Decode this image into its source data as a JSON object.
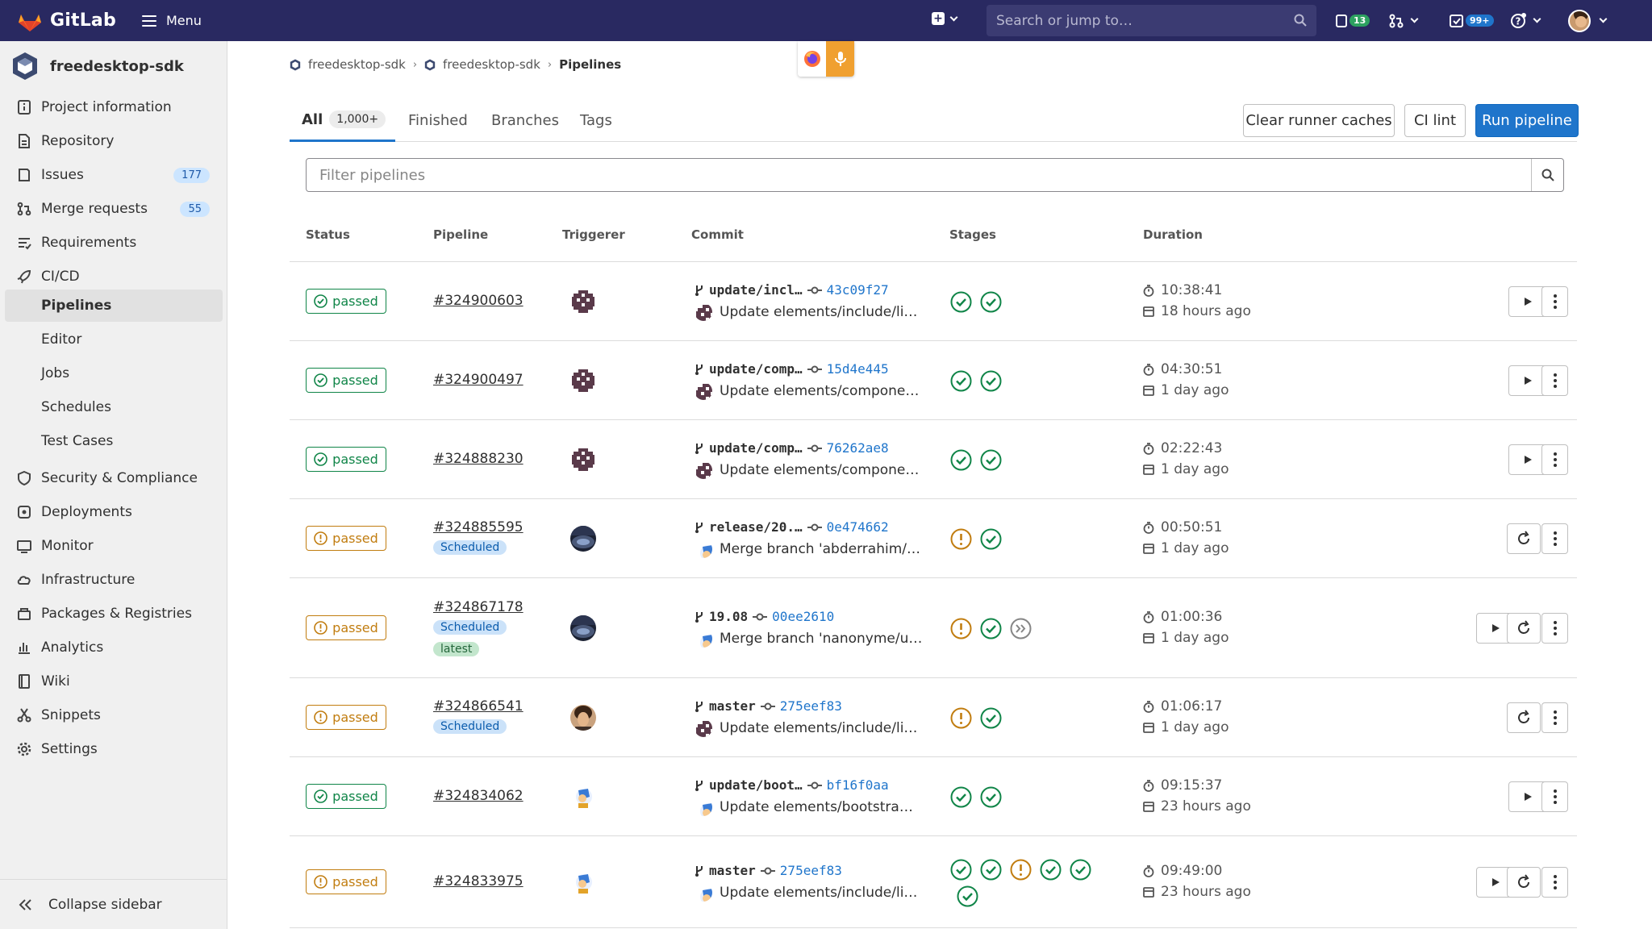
{
  "navbar": {
    "brand": "GitLab",
    "menu_label": "Menu",
    "search_placeholder": "Search or jump to…",
    "issues_count": "13",
    "todos_count": "99+"
  },
  "sidebar": {
    "project_name": "freedesktop-sdk",
    "items": [
      {
        "label": "Project information",
        "icon": "info-icon"
      },
      {
        "label": "Repository",
        "icon": "document-icon"
      },
      {
        "label": "Issues",
        "icon": "issues-icon",
        "count": "177"
      },
      {
        "label": "Merge requests",
        "icon": "merge-request-icon",
        "count": "55"
      },
      {
        "label": "Requirements",
        "icon": "requirements-icon"
      },
      {
        "label": "CI/CD",
        "icon": "rocket-icon"
      }
    ],
    "cicd_sub": [
      "Pipelines",
      "Editor",
      "Jobs",
      "Schedules",
      "Test Cases"
    ],
    "items2": [
      {
        "label": "Security & Compliance",
        "icon": "shield-icon"
      },
      {
        "label": "Deployments",
        "icon": "deployments-icon"
      },
      {
        "label": "Monitor",
        "icon": "monitor-icon"
      },
      {
        "label": "Infrastructure",
        "icon": "cloud-icon"
      },
      {
        "label": "Packages & Registries",
        "icon": "package-icon"
      },
      {
        "label": "Analytics",
        "icon": "chart-icon"
      },
      {
        "label": "Wiki",
        "icon": "book-icon"
      },
      {
        "label": "Snippets",
        "icon": "scissors-icon"
      },
      {
        "label": "Settings",
        "icon": "gear-icon"
      }
    ],
    "collapse_label": "Collapse sidebar"
  },
  "breadcrumb": [
    "freedesktop-sdk",
    "freedesktop-sdk",
    "Pipelines"
  ],
  "tabs": {
    "all": "All",
    "all_count": "1,000+",
    "finished": "Finished",
    "branches": "Branches",
    "tags": "Tags"
  },
  "buttons": {
    "clear_caches": "Clear runner caches",
    "ci_lint": "CI lint",
    "run_pipeline": "Run pipeline"
  },
  "filter_placeholder": "Filter pipelines",
  "columns": [
    "Status",
    "Pipeline",
    "Triggerer",
    "Commit",
    "Stages",
    "Duration"
  ],
  "pipelines": [
    {
      "status": "passed",
      "warn": false,
      "id": "#324900603",
      "ref": "update/incl…",
      "sha": "43c09f27",
      "message": "Update elements/include/li…",
      "avatar": "bot",
      "duration": "10:38:41",
      "finished": "18 hours ago",
      "tags": [],
      "stages": [
        "ok",
        "ok"
      ]
    },
    {
      "status": "passed",
      "warn": false,
      "id": "#324900497",
      "ref": "update/comp…",
      "sha": "15d4e445",
      "message": "Update elements/compone…",
      "avatar": "bot",
      "duration": "04:30:51",
      "finished": "1 day ago",
      "tags": [],
      "stages": [
        "ok",
        "ok"
      ]
    },
    {
      "status": "passed",
      "warn": false,
      "id": "#324888230",
      "ref": "update/comp…",
      "sha": "76262ae8",
      "message": "Update elements/compone…",
      "avatar": "bot",
      "duration": "02:22:43",
      "finished": "1 day ago",
      "tags": [],
      "stages": [
        "ok",
        "ok"
      ]
    },
    {
      "status": "passed",
      "warn": true,
      "id": "#324885595",
      "ref": "release/20.…",
      "sha": "0e474662",
      "message": "Merge branch 'abderrahim/…",
      "avatar": "dark",
      "duration": "00:50:51",
      "finished": "1 day ago",
      "tags": [
        "Scheduled"
      ],
      "stages": [
        "warn",
        "ok"
      ]
    },
    {
      "status": "passed",
      "warn": true,
      "id": "#324867178",
      "ref": "19.08",
      "sha": "00ee2610",
      "message": "Merge branch 'nanonyme/u…",
      "avatar": "dark",
      "duration": "01:00:36",
      "finished": "1 day ago",
      "tags": [
        "Scheduled",
        "latest"
      ],
      "stages": [
        "warn",
        "ok",
        "skip"
      ]
    },
    {
      "status": "passed",
      "warn": true,
      "id": "#324866541",
      "ref": "master",
      "sha": "275eef83",
      "message": "Update elements/include/li…",
      "avatar": "person",
      "duration": "01:06:17",
      "finished": "1 day ago",
      "tags": [
        "Scheduled"
      ],
      "stages": [
        "warn",
        "ok"
      ]
    },
    {
      "status": "passed",
      "warn": false,
      "id": "#324834062",
      "ref": "update/boot…",
      "sha": "bf16f0aa",
      "message": "Update elements/bootstra…",
      "avatar": "cartoon",
      "duration": "09:15:37",
      "finished": "23 hours ago",
      "tags": [],
      "stages": [
        "ok",
        "ok"
      ]
    },
    {
      "status": "passed",
      "warn": true,
      "id": "#324833975",
      "ref": "master",
      "sha": "275eef83",
      "message": "Update elements/include/li…",
      "avatar": "cartoon",
      "duration": "09:49:00",
      "finished": "23 hours ago",
      "tags": [],
      "stages": [
        "ok",
        "ok",
        "warn",
        "ok",
        "ok",
        "ok"
      ]
    }
  ]
}
